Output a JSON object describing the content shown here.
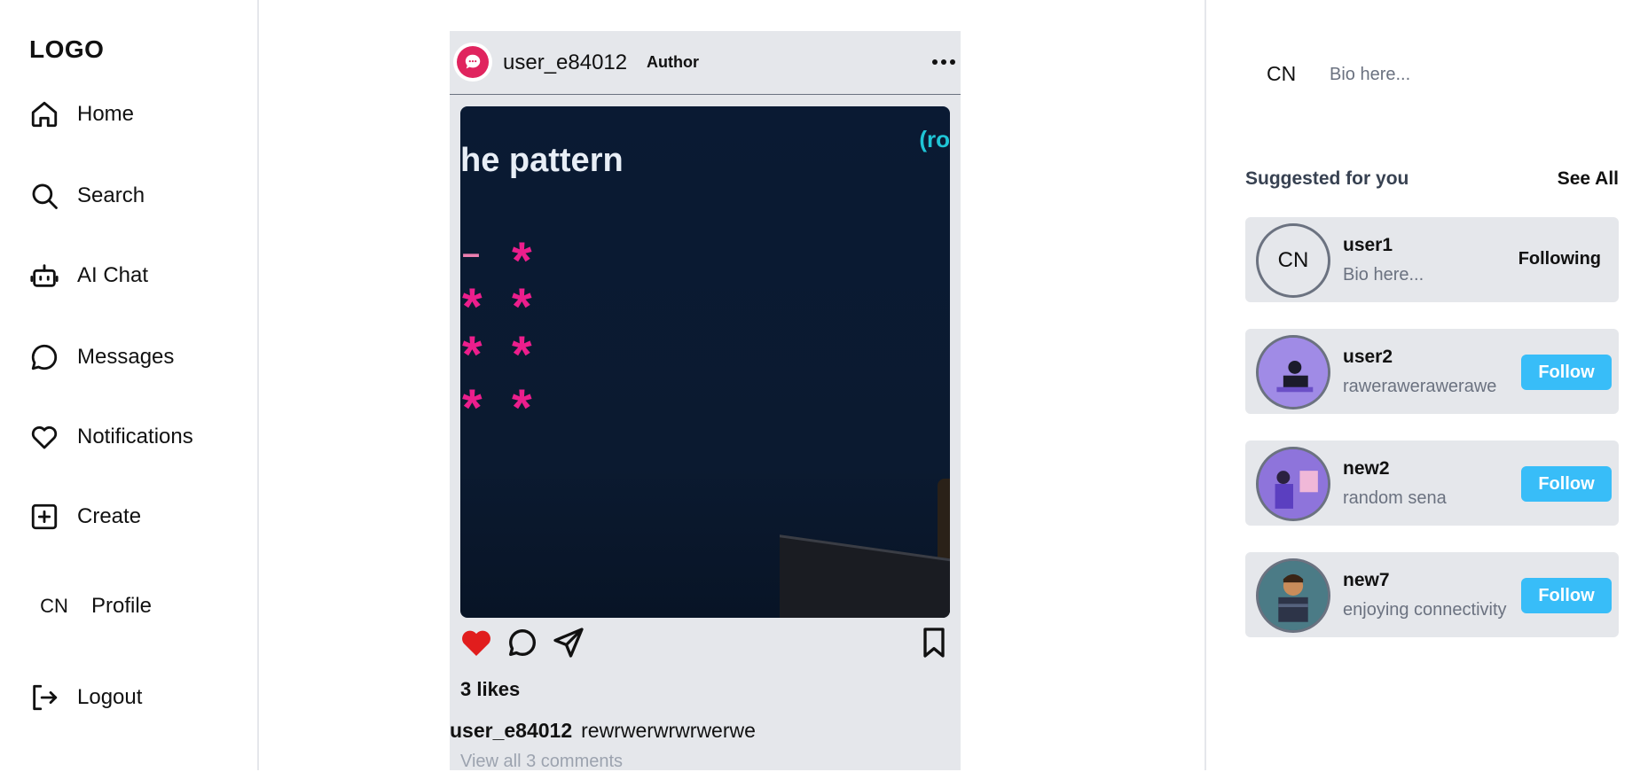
{
  "sidebar": {
    "logo": "LOGO",
    "items": [
      {
        "label": "Home",
        "icon": "home-icon"
      },
      {
        "label": "Search",
        "icon": "search-icon"
      },
      {
        "label": "AI Chat",
        "icon": "robot-icon"
      },
      {
        "label": "Messages",
        "icon": "message-icon"
      },
      {
        "label": "Notifications",
        "icon": "heart-icon"
      },
      {
        "label": "Create",
        "icon": "plus-square-icon"
      },
      {
        "label": "Profile",
        "icon": "avatar",
        "avatar_text": "CN"
      },
      {
        "label": "Logout",
        "icon": "logout-icon"
      }
    ]
  },
  "post": {
    "username": "user_e84012",
    "author_tag": "Author",
    "media": {
      "headline": "he pattern",
      "corner_text": "(ro"
    },
    "likes": "3 likes",
    "caption_user": "user_e84012",
    "caption_text": "rewrwerwrwrwerwe",
    "view_comments": "View all 3 comments",
    "liked": true,
    "colors": {
      "like": "#e11d1d",
      "media_accent": "#ec1e8c"
    }
  },
  "right": {
    "me": {
      "avatar_text": "CN",
      "bio": "Bio here..."
    },
    "suggested_title": "Suggested for you",
    "see_all": "See All",
    "suggestions": [
      {
        "username": "user1",
        "bio": "Bio here...",
        "avatar_text": "CN",
        "button": "Following"
      },
      {
        "username": "user2",
        "bio": "rawerawerawerawe",
        "button": "Follow"
      },
      {
        "username": "new2",
        "bio": "random sena",
        "button": "Follow"
      },
      {
        "username": "new7",
        "bio": "enjoying connectivity",
        "button": "Follow"
      }
    ],
    "colors": {
      "follow_button": "#38bdf8"
    }
  }
}
